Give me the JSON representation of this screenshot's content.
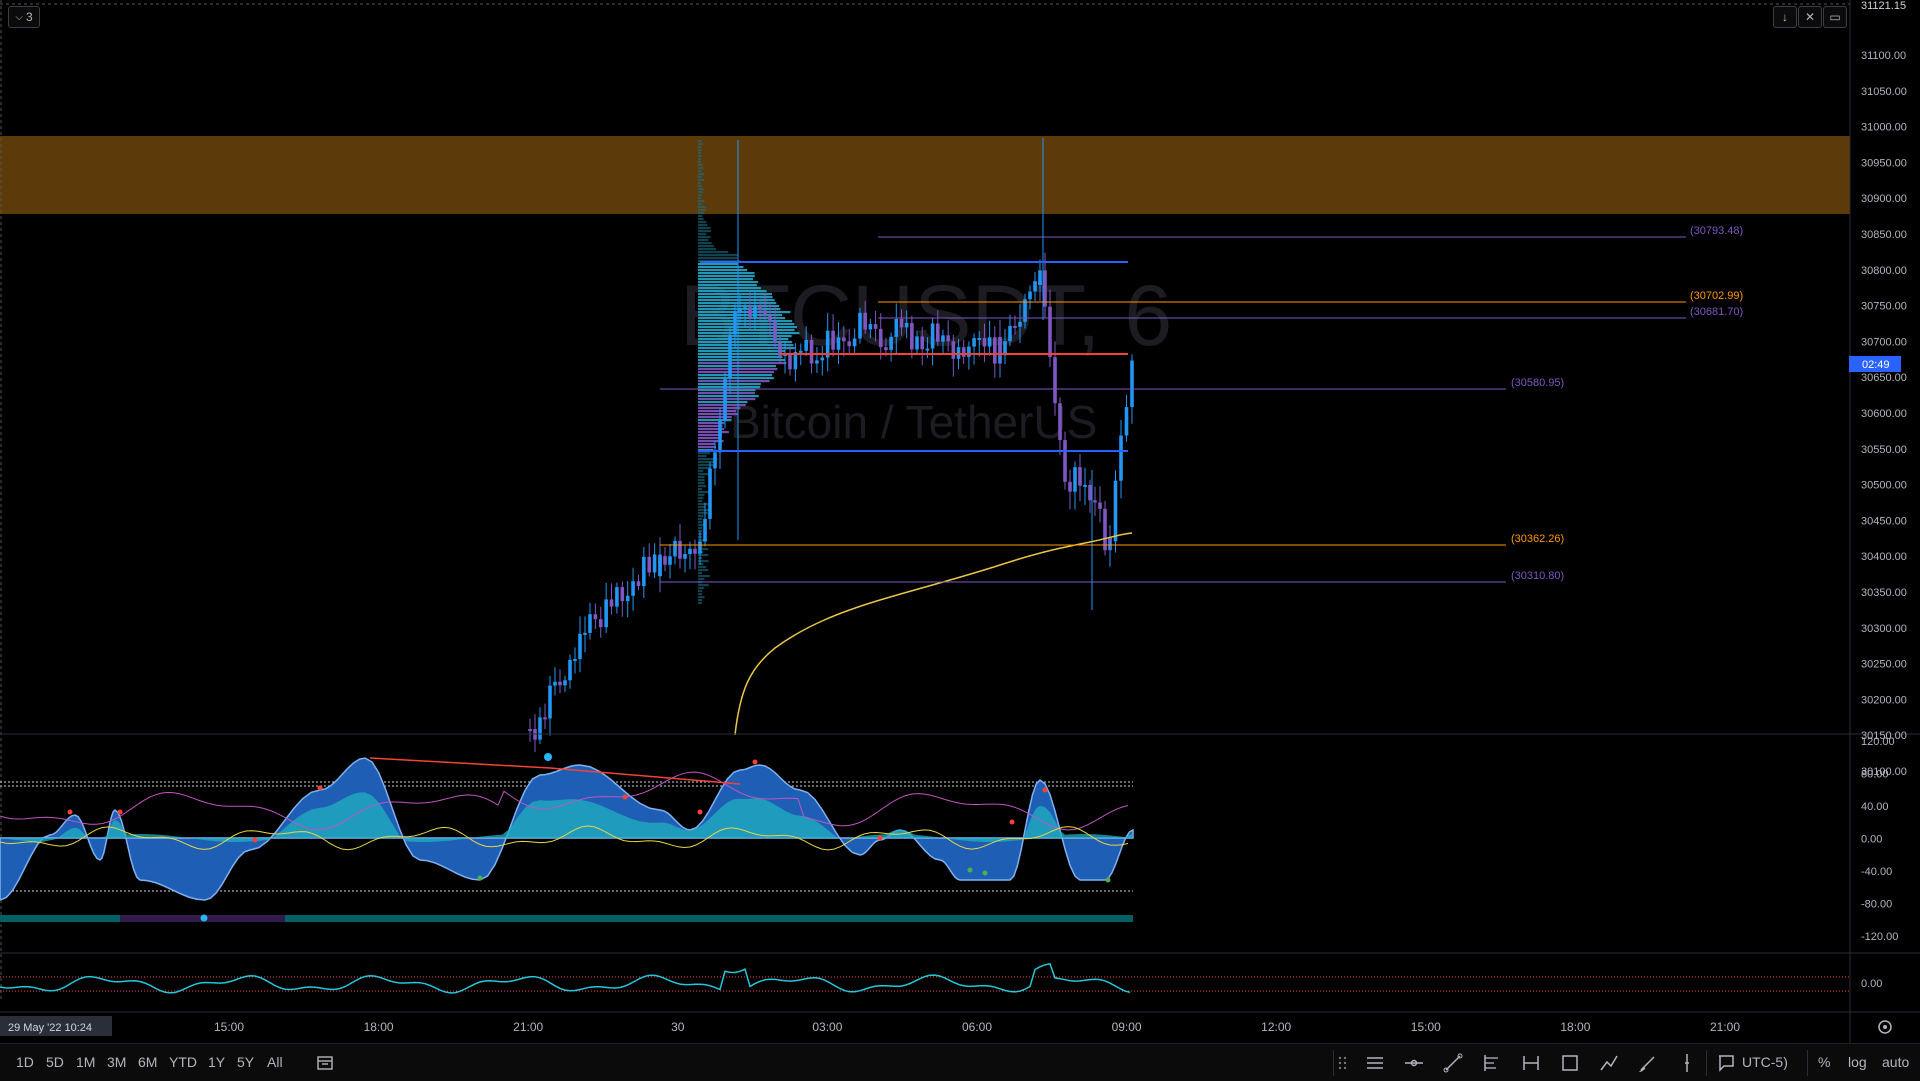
{
  "watermark": {
    "symbol": "BTCUSDT, 6",
    "description": "Bitcoin / TetherUS"
  },
  "top": {
    "collapse_count": "3"
  },
  "price_axis": {
    "ticks": [
      "31100.00",
      "31050.00",
      "31000.00",
      "30950.00",
      "30900.00",
      "30850.00",
      "30800.00",
      "30750.00",
      "30700.00",
      "30650.00",
      "30600.00",
      "30550.00",
      "30500.00",
      "30450.00",
      "30400.00",
      "30350.00",
      "30300.00",
      "30250.00",
      "30200.00",
      "30150.00",
      "30100.00"
    ],
    "top_label": "31121.15",
    "last_label": "02:49"
  },
  "osc_axis": {
    "ticks": [
      "120.00",
      "80.00",
      "40.00",
      "0.00",
      "-40.00",
      "-80.00",
      "-120.00"
    ]
  },
  "osc2_axis": {
    "ticks": [
      "0.00"
    ]
  },
  "levels": [
    {
      "label": "(30793.48)",
      "color": "#7e57c2"
    },
    {
      "label": "(30702.99)",
      "color": "#ff9800"
    },
    {
      "label": "(30681.70)",
      "color": "#7e57c2"
    },
    {
      "label": "(30580.95)",
      "color": "#7e57c2"
    },
    {
      "label": "(30362.26)",
      "color": "#ff9800"
    },
    {
      "label": "(30310.80)",
      "color": "#7e57c2"
    }
  ],
  "time_axis": {
    "ticks": [
      "15:00",
      "18:00",
      "21:00",
      "30",
      "03:00",
      "06:00",
      "09:00",
      "12:00",
      "15:00",
      "18:00",
      "21:00"
    ],
    "current": "29 May '22   10:24"
  },
  "bottom": {
    "timeframes": [
      "1D",
      "5D",
      "1M",
      "3M",
      "6M",
      "YTD",
      "1Y",
      "5Y",
      "All"
    ],
    "timezone": "UTC-5)",
    "percent": "%",
    "log": "log",
    "auto": "auto"
  },
  "colors": {
    "zone": "#5c3a0a",
    "up": "#2196f3",
    "down": "#7e57c2",
    "vwap": "#e8c547",
    "poc": "#f44336"
  }
}
